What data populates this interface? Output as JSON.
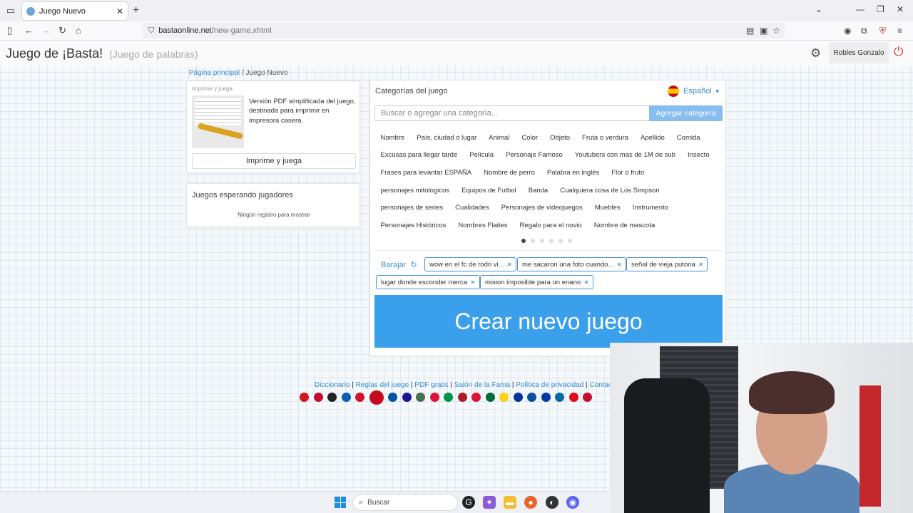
{
  "browser": {
    "tab_title": "Juego Nuevo",
    "url_host": "bastaonline.net",
    "url_path": "/new-game.xhtml"
  },
  "header": {
    "title": "Juego de ¡Basta!",
    "subtitle": "(Juego de palabras)",
    "user_name": "Robles Gonzalo"
  },
  "breadcrumb": {
    "home": "Página principal",
    "separator": "/",
    "current": "Juego Nuevo"
  },
  "print_panel": {
    "title": "Imprime y juega",
    "description": "Versión PDF simplificada del juego, destinada para imprimir en impresora casera.",
    "button": "Imprime y juega"
  },
  "waiting_panel": {
    "title": "Juegos esperando jugadores",
    "empty": "Ningún registro para mostrar"
  },
  "categories_panel": {
    "title": "Categorías del juego",
    "language": "Español",
    "search_placeholder": "Buscar o agregar una categoría...",
    "add_button": "Agregar categoría",
    "chip_rows": [
      [
        "Nombre",
        "País, ciudad o lugar",
        "Animal",
        "Color",
        "Objeto",
        "Fruta o verdura",
        "Apellido",
        "Comida"
      ],
      [
        "Excusas para llegar tarde",
        "Película",
        "Personaje Famoso",
        "Youtubers con mas de 1M de sub",
        "Insecto"
      ],
      [
        "Frases para levantar ESPAÑA",
        "Nombre de perro",
        "Palabra en inglés",
        "Flor o fruto"
      ],
      [
        "personajes mitologicos",
        "Equipos de Futbol",
        "Banda",
        "Cualquiera cosa de Los Simpson"
      ],
      [
        "personajes de series",
        "Cualidades",
        "Personajes de videojuegos",
        "Muebles",
        "Instrumento"
      ],
      [
        "Personajes Históricos",
        "Nombres Flaites",
        "Regalo para el novio",
        "Nombre de mascota"
      ]
    ],
    "page_dots": 6,
    "active_dot": 0,
    "shuffle_label": "Barajar",
    "selected": [
      "wow en el fc de rodri vi...",
      "me sacaron una foto cuando...",
      "señal de vieja putona",
      "lugar donde esconder merca",
      "mision imposible para un enano"
    ],
    "create_button": "Crear nuevo juego"
  },
  "footer": {
    "links": [
      "Diccionario",
      "Reglas del juego",
      "PDF gratis",
      "Salón de la Fama",
      "Política de privacidad",
      "Contacto"
    ],
    "flag_colors": [
      "#d7141a",
      "#c60c30",
      "#222222",
      "#0d5eaf",
      "#cf142b",
      "#c60b1e",
      "#0055a4",
      "#171796",
      "#477050",
      "#dc143c",
      "#009246",
      "#ae1c28",
      "#dc143c",
      "#046a38",
      "#fcd116",
      "#0033a0",
      "#0b4ea2",
      "#0039a6",
      "#006aa7",
      "#e30a17",
      "#c8102e"
    ]
  },
  "taskbar": {
    "search_label": "Buscar"
  }
}
